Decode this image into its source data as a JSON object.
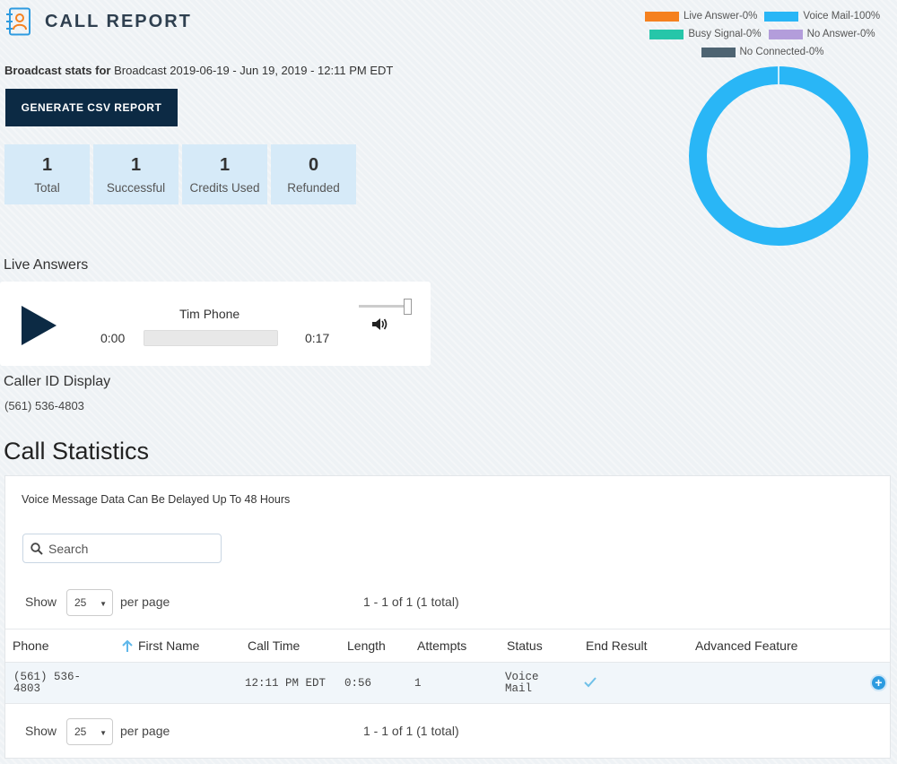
{
  "header": {
    "title": "CALL REPORT",
    "icon": "contact-book-icon"
  },
  "broadcast": {
    "label": "Broadcast stats for",
    "value": "Broadcast 2019-06-19 - Jun 19, 2019 - 12:11 PM EDT"
  },
  "csv_button": "GENERATE CSV REPORT",
  "stats": [
    {
      "value": "1",
      "label": "Total"
    },
    {
      "value": "1",
      "label": "Successful"
    },
    {
      "value": "1",
      "label": "Credits Used"
    },
    {
      "value": "0",
      "label": "Refunded"
    }
  ],
  "legend": [
    {
      "label": "Live Answer-0%",
      "color": "#f5811f"
    },
    {
      "label": "Voice Mail-100%",
      "color": "#29b6f6"
    },
    {
      "label": "Busy Signal-0%",
      "color": "#26c6a9"
    },
    {
      "label": "No Answer-0%",
      "color": "#b39ddb"
    },
    {
      "label": "No Connected-0%",
      "color": "#4e6472"
    }
  ],
  "chart_data": {
    "type": "pie",
    "categories": [
      "Live Answer",
      "Voice Mail",
      "Busy Signal",
      "No Answer",
      "No Connected"
    ],
    "values": [
      0,
      100,
      0,
      0,
      0
    ]
  },
  "live_answers": {
    "heading": "Live Answers",
    "track_name": "Tim Phone",
    "current_time": "0:00",
    "duration": "0:17",
    "volume": 1.0
  },
  "caller_id": {
    "heading": "Caller ID Display",
    "value": "(561) 536-4803"
  },
  "call_statistics": {
    "title": "Call Statistics",
    "note": "Voice Message Data Can Be Delayed Up To 48 Hours",
    "search_placeholder": "Search",
    "pager": {
      "show": "Show",
      "per_page_value": "25",
      "per_page": "per page",
      "range": "1 - 1 of 1 (1 total)"
    },
    "columns": [
      "Phone",
      "First Name",
      "Call Time",
      "Length",
      "Attempts",
      "Status",
      "End Result",
      "Advanced Feature"
    ],
    "rows": [
      {
        "phone_1": "(561) 536-",
        "phone_2": "4803",
        "first_name": "",
        "call_time": "12:11 PM EDT",
        "length": "0:56",
        "attempts": "1",
        "status_1": "Voice",
        "status_2": "Mail",
        "end_result": "check-icon"
      }
    ]
  }
}
